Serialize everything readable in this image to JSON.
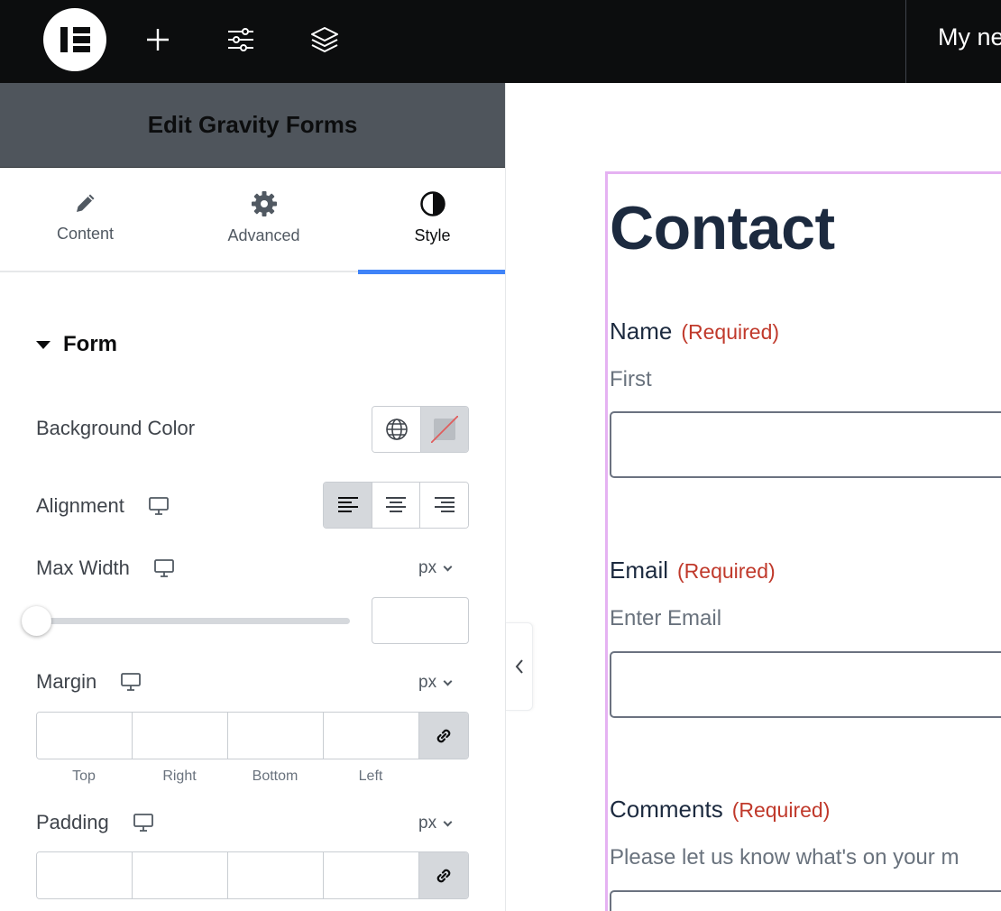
{
  "topbar": {
    "logo_icon": "elementor-logo-icon",
    "add_icon": "plus-icon",
    "settings_icon": "sliders-icon",
    "structure_icon": "layers-icon",
    "document_title": "My ne"
  },
  "panel": {
    "header_title": "Edit Gravity Forms",
    "tabs": [
      {
        "label": "Content",
        "icon": "pencil-icon"
      },
      {
        "label": "Advanced",
        "icon": "gear-icon"
      },
      {
        "label": "Style",
        "icon": "half-circle-icon",
        "active": true
      }
    ],
    "section": {
      "title": "Form"
    },
    "controls": {
      "background_color": {
        "label": "Background Color"
      },
      "alignment": {
        "label": "Alignment",
        "selected": "left"
      },
      "max_width": {
        "label": "Max Width",
        "unit": "px",
        "value": ""
      },
      "margin": {
        "label": "Margin",
        "unit": "px",
        "sides": [
          "Top",
          "Right",
          "Bottom",
          "Left"
        ]
      },
      "padding": {
        "label": "Padding",
        "unit": "px"
      }
    }
  },
  "preview": {
    "title": "Contact",
    "fields": [
      {
        "label": "Name",
        "required": "(Required)",
        "sublabel": "First"
      },
      {
        "label": "Email",
        "required": "(Required)",
        "sublabel": "Enter Email"
      },
      {
        "label": "Comments",
        "required": "(Required)",
        "sublabel": "Please let us know what's on your m"
      }
    ]
  },
  "colors": {
    "accent": "#3f83f8",
    "required": "#c0392b",
    "frame": "#e5b2f2"
  }
}
